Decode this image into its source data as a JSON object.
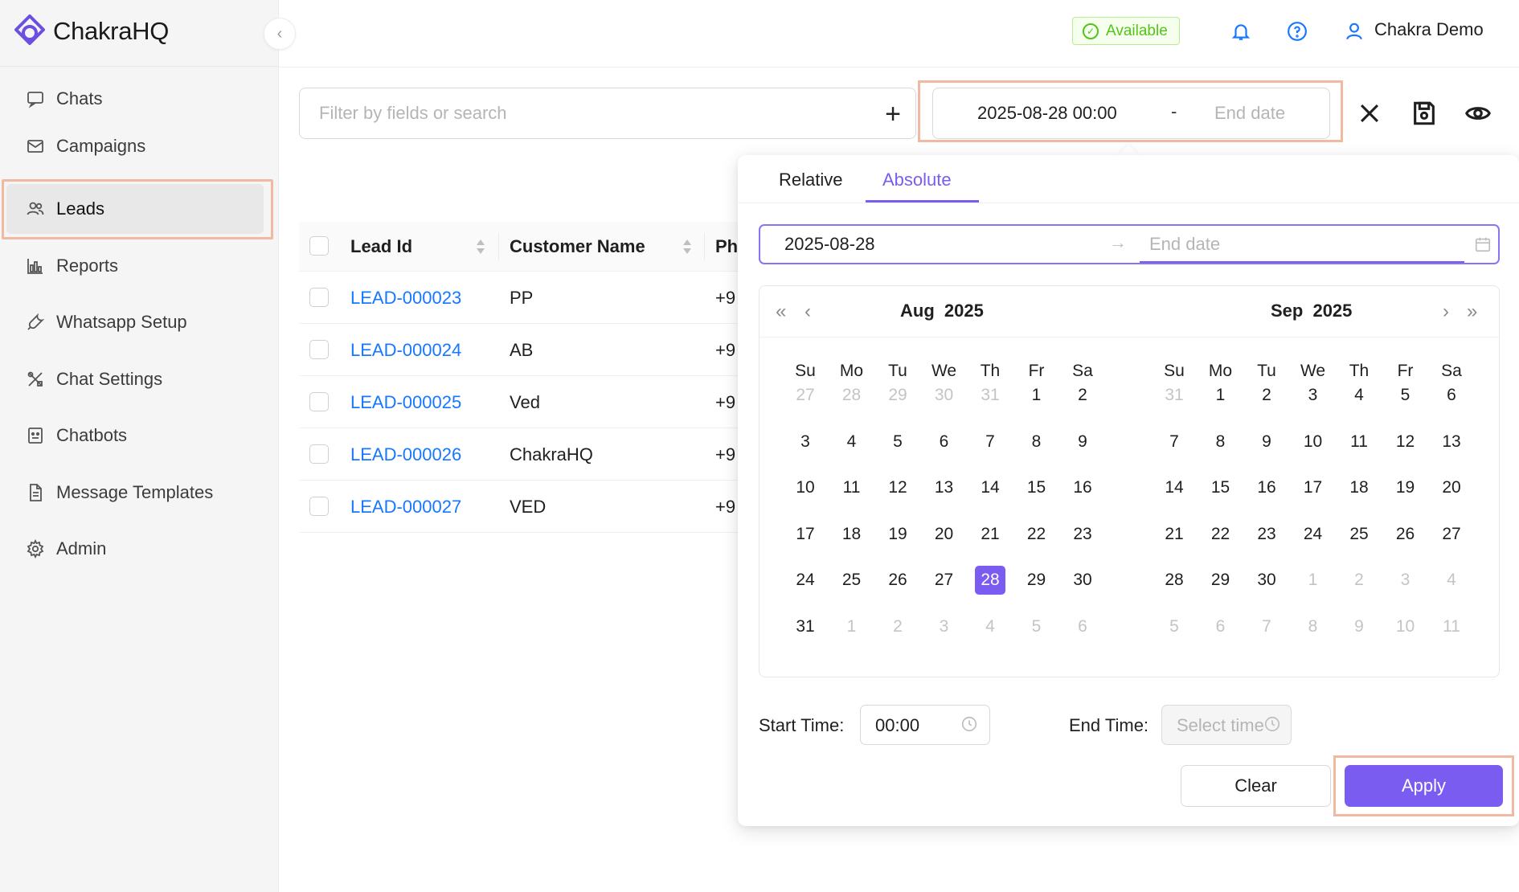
{
  "brand": {
    "name": "ChakraHQ"
  },
  "sidebar": {
    "items": [
      {
        "label": "Chats",
        "icon": "chat-icon"
      },
      {
        "label": "Campaigns",
        "icon": "mail-icon"
      },
      {
        "label": "Leads",
        "icon": "users-icon",
        "active": true
      },
      {
        "label": "Reports",
        "icon": "bar-chart-icon"
      },
      {
        "label": "Whatsapp Setup",
        "icon": "wrench-icon"
      },
      {
        "label": "Chat Settings",
        "icon": "tools-icon"
      },
      {
        "label": "Chatbots",
        "icon": "robot-icon"
      },
      {
        "label": "Message Templates",
        "icon": "file-icon"
      },
      {
        "label": "Admin",
        "icon": "gear-icon"
      }
    ]
  },
  "header": {
    "status": "Available",
    "user_name": "Chakra Demo"
  },
  "filter": {
    "placeholder": "Filter by fields or search",
    "range_start": "2025-08-28 00:00",
    "range_sep": "-",
    "range_end_placeholder": "End date"
  },
  "table": {
    "columns": [
      "Lead Id",
      "Customer Name",
      "Ph"
    ],
    "rows": [
      {
        "id": "LEAD-000023",
        "name": "PP",
        "ph": "+9"
      },
      {
        "id": "LEAD-000024",
        "name": "AB",
        "ph": "+9"
      },
      {
        "id": "LEAD-000025",
        "name": "Ved",
        "ph": "+9"
      },
      {
        "id": "LEAD-000026",
        "name": "ChakraHQ",
        "ph": "+9"
      },
      {
        "id": "LEAD-000027",
        "name": "VED",
        "ph": "+9"
      }
    ]
  },
  "picker": {
    "tabs": [
      "Relative",
      "Absolute"
    ],
    "active_tab": "Absolute",
    "start_date": "2025-08-28",
    "arrow": "→",
    "end_placeholder": "End date",
    "weekdays": [
      "Su",
      "Mo",
      "Tu",
      "We",
      "Th",
      "Fr",
      "Sa"
    ],
    "left_month": {
      "title": "Aug  2025",
      "days": [
        "27",
        "28",
        "29",
        "30",
        "31",
        "1",
        "2",
        "3",
        "4",
        "5",
        "6",
        "7",
        "8",
        "9",
        "10",
        "11",
        "12",
        "13",
        "14",
        "15",
        "16",
        "17",
        "18",
        "19",
        "20",
        "21",
        "22",
        "23",
        "24",
        "25",
        "26",
        "27",
        "28",
        "29",
        "30",
        "31",
        "1",
        "2",
        "3",
        "4",
        "5",
        "6"
      ],
      "leading_muted": 5,
      "trailing_muted": 6,
      "selected_index": 32
    },
    "right_month": {
      "title": "Sep  2025",
      "days": [
        "31",
        "1",
        "2",
        "3",
        "4",
        "5",
        "6",
        "7",
        "8",
        "9",
        "10",
        "11",
        "12",
        "13",
        "14",
        "15",
        "16",
        "17",
        "18",
        "19",
        "20",
        "21",
        "22",
        "23",
        "24",
        "25",
        "26",
        "27",
        "28",
        "29",
        "30",
        "1",
        "2",
        "3",
        "4",
        "5",
        "6",
        "7",
        "8",
        "9",
        "10",
        "11"
      ],
      "leading_muted": 1,
      "trailing_muted": 11,
      "selected_index": -1
    },
    "start_time_label": "Start Time:",
    "start_time_value": "00:00",
    "end_time_label": "End Time:",
    "end_time_placeholder": "Select time",
    "clear_label": "Clear",
    "apply_label": "Apply"
  },
  "colors": {
    "accent": "#7b5cf0",
    "link": "#1677ff",
    "available": "#52c41a",
    "highlight": "#f2b9a2"
  }
}
